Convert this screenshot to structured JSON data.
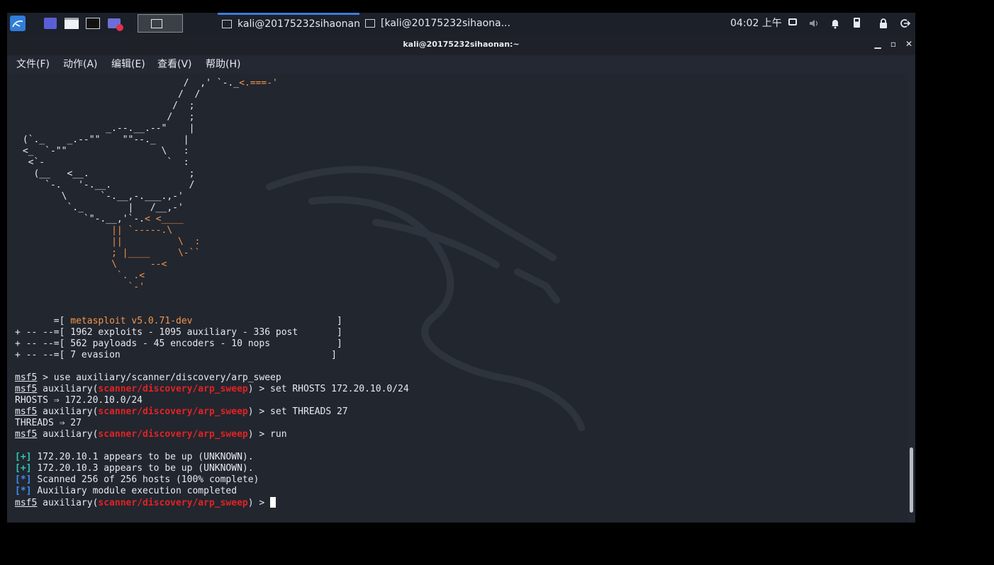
{
  "taskbar": {
    "task1_label": "kali@20175232sihaonan...",
    "task2_label": "[kali@20175232sihaona...",
    "clock": "04:02 上午"
  },
  "window": {
    "title": "kali@20175232sihaonan:~",
    "menu": [
      "文件(F)",
      "动作(A)",
      "编辑(E)",
      "查看(V)",
      "帮助(H)"
    ]
  },
  "terminal": {
    "banner": {
      "version": "metasploit v5.0.71-dev",
      "line2": "1962 exploits - 1095 auxiliary - 336 post",
      "line3": "562 payloads - 45 encoders - 10 nops",
      "line4": "7 evasion"
    },
    "prompt": "msf5",
    "module": "scanner/discovery/arp_sweep",
    "cmd1": "use auxiliary/scanner/discovery/arp_sweep",
    "cmd2": "set RHOSTS 172.20.10.0/24",
    "out2": "RHOSTS ⇒ 172.20.10.0/24",
    "cmd3": "set THREADS 27",
    "out3": "THREADS ⇒ 27",
    "cmd4": "run",
    "results": [
      {
        "tag": "+",
        "text": "172.20.10.1 appears to be up (UNKNOWN)."
      },
      {
        "tag": "+",
        "text": "172.20.10.3 appears to be up (UNKNOWN)."
      },
      {
        "tag": "*",
        "text": "Scanned 256 of 256 hosts (100% complete)"
      },
      {
        "tag": "*",
        "text": "Auxiliary module execution completed"
      }
    ]
  },
  "colors": {
    "prompt_module": "#e12323",
    "banner_accent": "#f2964a",
    "status_plus": "#2ec7b8",
    "status_star": "#3d8ef0"
  }
}
